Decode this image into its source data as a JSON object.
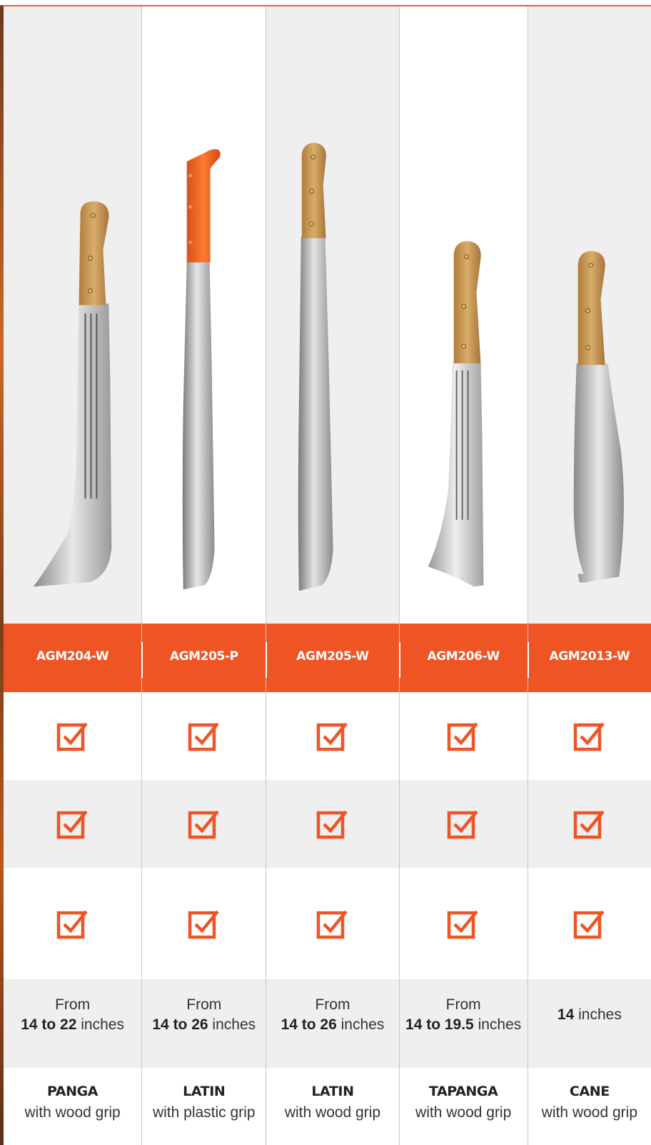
{
  "colors": {
    "accent": "#ee5424",
    "row_alt": "#efefef",
    "wood": "#c79a55",
    "plastic": "#f06a22"
  },
  "columns": [
    {
      "model": "AGM204-W",
      "size_prefix": "From",
      "size_value": "14 to 22",
      "size_unit": " inches",
      "type": "PANGA",
      "grip": "with wood grip",
      "handle": "wood",
      "checks": [
        "checkbox-checked-icon",
        "checkbox-checked-icon",
        "checkbox-checked-icon"
      ]
    },
    {
      "model": "AGM205-P",
      "size_prefix": "From",
      "size_value": "14 to 26",
      "size_unit": " inches",
      "type": "LATIN",
      "grip": "with plastic grip",
      "handle": "plastic",
      "checks": [
        "checkbox-checked-icon",
        "checkbox-checked-icon",
        "checkbox-checked-icon"
      ]
    },
    {
      "model": "AGM205-W",
      "size_prefix": "From",
      "size_value": "14 to 26",
      "size_unit": " inches",
      "type": "LATIN",
      "grip": "with wood grip",
      "handle": "wood",
      "checks": [
        "checkbox-checked-icon",
        "checkbox-checked-icon",
        "checkbox-checked-icon"
      ]
    },
    {
      "model": "AGM206-W",
      "size_prefix": "From",
      "size_value": "14 to 19.5",
      "size_unit": " inches",
      "type": "TAPANGA",
      "grip": "with wood grip",
      "handle": "wood",
      "checks": [
        "checkbox-checked-icon",
        "checkbox-checked-icon",
        "checkbox-checked-icon"
      ]
    },
    {
      "model": "AGM2013-W",
      "size_prefix": "",
      "size_value": "14",
      "size_unit": " inches",
      "type": "CANE",
      "grip": "with wood grip",
      "handle": "wood",
      "checks": [
        "checkbox-checked-icon",
        "checkbox-checked-icon",
        "checkbox-checked-icon"
      ]
    }
  ]
}
